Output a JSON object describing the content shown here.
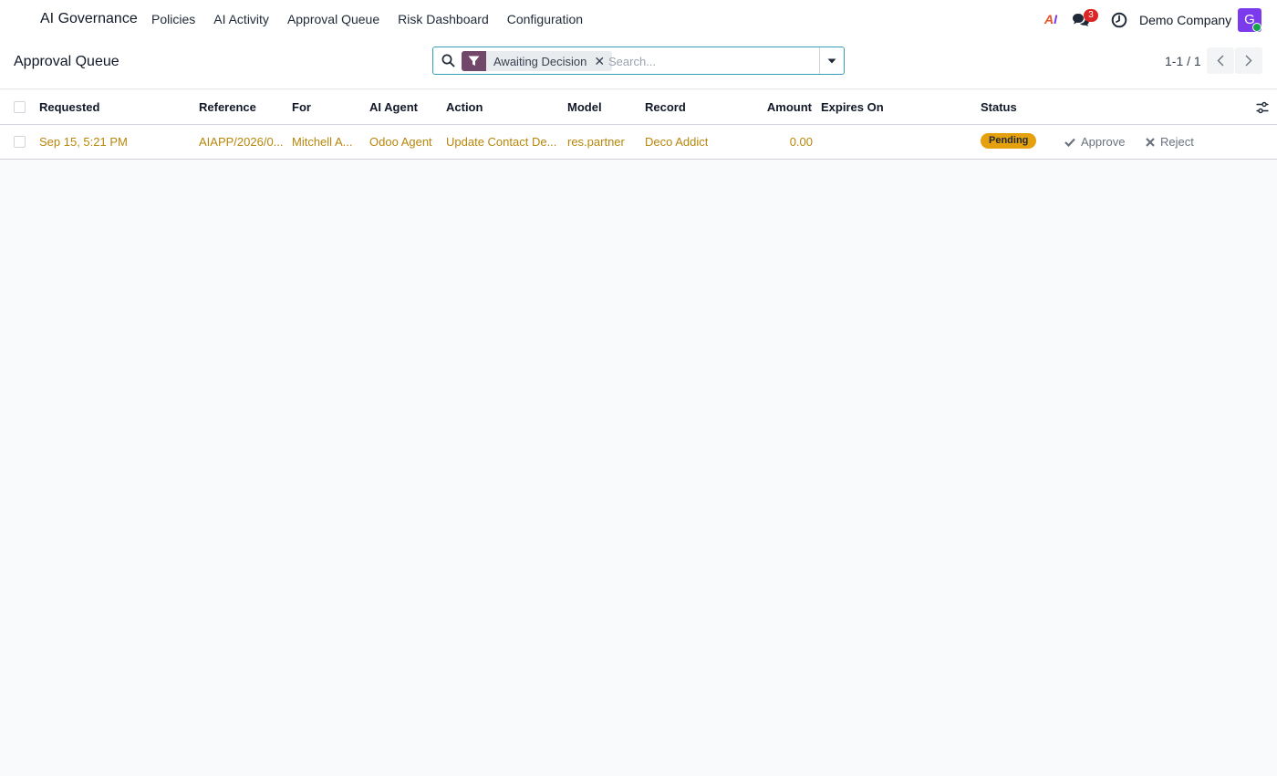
{
  "navbar": {
    "brand": "AI Governance",
    "menu": [
      "Policies",
      "AI Activity",
      "Approval Queue",
      "Risk Dashboard",
      "Configuration"
    ],
    "ai_logo": {
      "a": "A",
      "i": "I"
    },
    "chat_count": "3",
    "company": "Demo Company",
    "avatar_letter": "G"
  },
  "control": {
    "title": "Approval Queue",
    "search": {
      "facet_label": "Awaiting Decision",
      "placeholder": "Search..."
    },
    "pager": "1-1 / 1"
  },
  "table": {
    "columns": [
      "Requested",
      "Reference",
      "For",
      "AI Agent",
      "Action",
      "Model",
      "Record",
      "Amount",
      "Expires On",
      "Status"
    ],
    "rows": [
      {
        "requested": "Sep 15, 5:21 PM",
        "reference": "AIAPP/2026/0...",
        "for": "Mitchell A...",
        "agent": "Odoo Agent",
        "action": "Update Contact De...",
        "model": "res.partner",
        "record": "Deco Addict",
        "amount": "0.00",
        "expires": "",
        "status": "Pending",
        "approve": "Approve",
        "reject": "Reject"
      }
    ]
  },
  "colors": {
    "accent": "#71486a",
    "link": "#b8860b",
    "pending": "#e5a00d",
    "avatar": "#7c3aed"
  }
}
